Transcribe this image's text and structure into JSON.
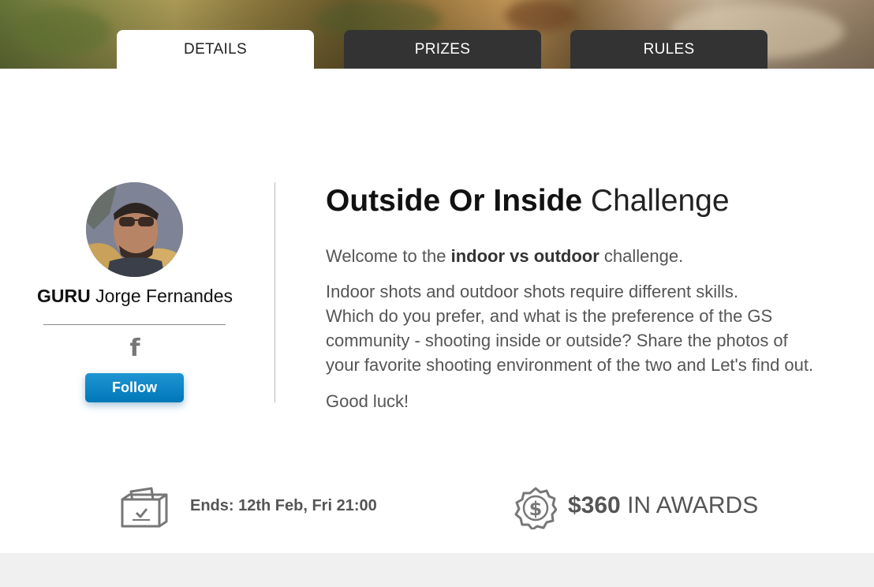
{
  "tabs": [
    {
      "label": "DETAILS",
      "active": true
    },
    {
      "label": "PRIZES",
      "active": false
    },
    {
      "label": "RULES",
      "active": false
    }
  ],
  "profile": {
    "title": "GURU",
    "name": "Jorge Fernandes",
    "social_icon": "facebook-icon",
    "follow_label": "Follow"
  },
  "challenge": {
    "title_bold": "Outside Or Inside",
    "title_light": "Challenge",
    "intro_prefix": "Welcome to the",
    "intro_bold": "indoor vs outdoor",
    "intro_suffix": "challenge.",
    "body_lines": [
      "Indoor shots and outdoor shots require different skills.",
      "Which do you prefer, and what is the preference of the GS",
      "community - shooting inside or outside? Share the photos of",
      "your favorite shooting environment of the two and Let's find out."
    ],
    "closing": "Good luck!"
  },
  "footer": {
    "ends_label": "Ends: 12th Feb, Fri 21:00",
    "awards_amount": "$360",
    "awards_label": "IN AWARDS",
    "ballot_icon": "ballot-box-icon",
    "award_icon": "dollar-badge-icon"
  },
  "colors": {
    "tab_dark": "#333333",
    "follow_button": "#0a85c6",
    "icon_gray": "#777777"
  }
}
